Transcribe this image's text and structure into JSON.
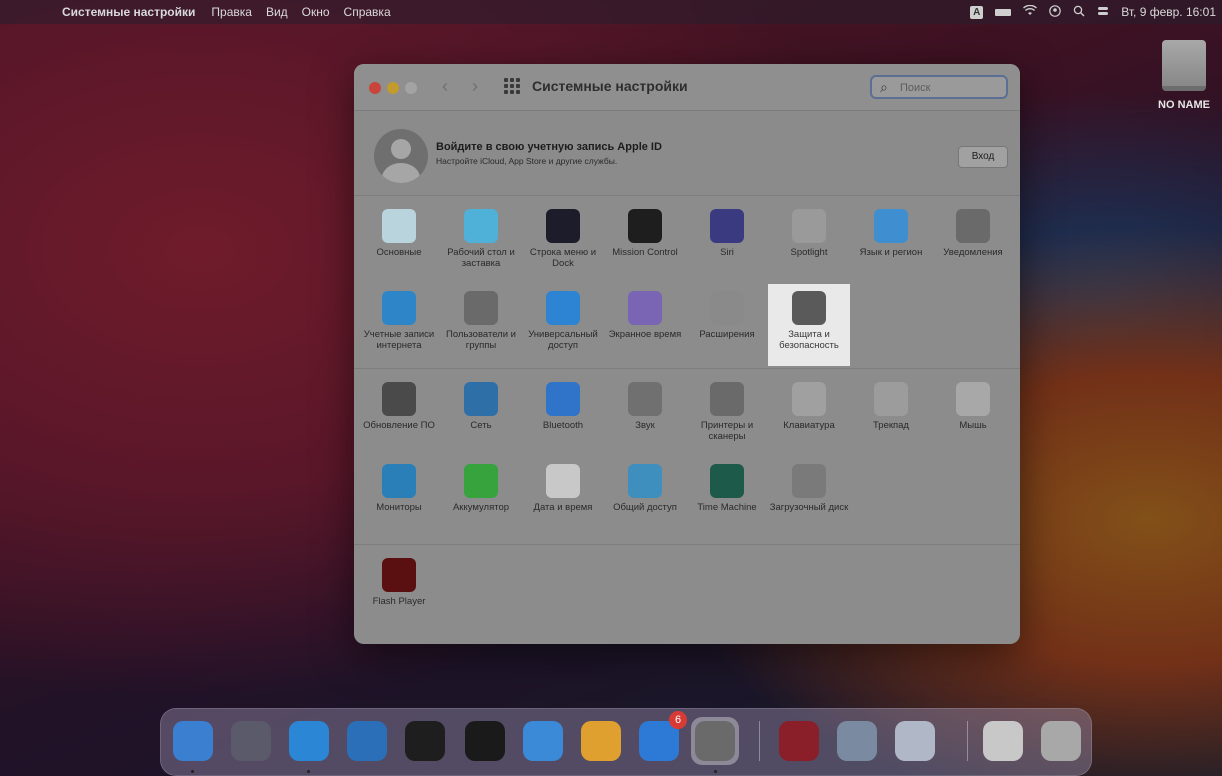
{
  "menubar": {
    "apple_glyph": "",
    "app_name": "Системные настройки",
    "items": [
      "Правка",
      "Вид",
      "Окно",
      "Справка"
    ],
    "input_source": "A",
    "clock": "Вт, 9 февр. 16:01"
  },
  "desktop": {
    "drive_label": "NO NAME"
  },
  "window": {
    "title": "Системные настройки",
    "nav_back": "‹",
    "nav_forward": "›",
    "search_glyph": "⌕",
    "search_placeholder": "Поиск",
    "search_value": ""
  },
  "apple_id": {
    "title": "Войдите в свою учетную запись Apple ID",
    "subtitle": "Настройте iCloud, App Store и другие службы.",
    "login_button": "Вход"
  },
  "section1": [
    {
      "name": "general",
      "label": "Основные",
      "color": "#b9d4dc"
    },
    {
      "name": "desktop",
      "label": "Рабочий стол и заставка",
      "color": "#4fb0d8"
    },
    {
      "name": "dock",
      "label": "Строка меню и Dock",
      "color": "#1c1c2a"
    },
    {
      "name": "mission-control",
      "label": "Mission Control",
      "color": "#1e1e1e"
    },
    {
      "name": "siri",
      "label": "Siri",
      "color": "#3a3a80"
    },
    {
      "name": "spotlight",
      "label": "Spotlight",
      "color": "#9a9a9a"
    },
    {
      "name": "language",
      "label": "Язык и регион",
      "color": "#3f8fd0"
    },
    {
      "name": "notifications",
      "label": "Уведомления",
      "color": "#6a6a6a"
    },
    {
      "name": "internet-accounts",
      "label": "Учетные записи интернета",
      "color": "#2e86c8"
    },
    {
      "name": "users",
      "label": "Пользователи и группы",
      "color": "#6a6a6a"
    },
    {
      "name": "accessibility",
      "label": "Универсальный доступ",
      "color": "#2d84d2"
    },
    {
      "name": "screen-time",
      "label": "Экранное время",
      "color": "#7a64b4"
    },
    {
      "name": "extensions",
      "label": "Расширения",
      "color": "#8a8a8a"
    },
    {
      "name": "security",
      "label": "Защита и безопасность",
      "color": "#5a5a5a"
    }
  ],
  "section2": [
    {
      "name": "software-update",
      "label": "Обновление ПО",
      "color": "#4a4a4a"
    },
    {
      "name": "network",
      "label": "Сеть",
      "color": "#2f6fa8"
    },
    {
      "name": "bluetooth",
      "label": "Bluetooth",
      "color": "#2f74c8"
    },
    {
      "name": "sound",
      "label": "Звук",
      "color": "#707070"
    },
    {
      "name": "printers",
      "label": "Принтеры и сканеры",
      "color": "#6a6a6a"
    },
    {
      "name": "keyboard",
      "label": "Клавиатура",
      "color": "#a0a0a0"
    },
    {
      "name": "trackpad",
      "label": "Трекпад",
      "color": "#9c9c9c"
    },
    {
      "name": "mouse",
      "label": "Мышь",
      "color": "#a8a8a8"
    },
    {
      "name": "displays",
      "label": "Мониторы",
      "color": "#2a7fb8"
    },
    {
      "name": "battery",
      "label": "Аккумулятор",
      "color": "#36a33c"
    },
    {
      "name": "date-time",
      "label": "Дата и время",
      "color": "#c8c8c8"
    },
    {
      "name": "sharing",
      "label": "Общий доступ",
      "color": "#3f8fbe"
    },
    {
      "name": "time-machine",
      "label": "Time Machine",
      "color": "#1d5a4a"
    },
    {
      "name": "startup-disk",
      "label": "Загрузочный диск",
      "color": "#7a7a7a"
    }
  ],
  "section3": [
    {
      "name": "flash-player",
      "label": "Flash Player",
      "color": "#5a1010"
    }
  ],
  "dock": {
    "appstore_badge": "6",
    "items": [
      {
        "name": "finder",
        "color": "#3a7fd0"
      },
      {
        "name": "launchpad",
        "color": "#5a5a6a"
      },
      {
        "name": "safari",
        "color": "#2c86d6"
      },
      {
        "name": "vscode",
        "color": "#2a6fb8"
      },
      {
        "name": "activity-monitor",
        "color": "#1e1e1e"
      },
      {
        "name": "terminal",
        "color": "#1a1a1a"
      },
      {
        "name": "mail",
        "color": "#3a8ad8"
      },
      {
        "name": "photos",
        "color": "#e0a030"
      },
      {
        "name": "app-store",
        "color": "#2d7ad6"
      },
      {
        "name": "system-preferences",
        "color": "#6a6a6a"
      },
      {
        "name": "rar",
        "color": "#8a1f2a"
      },
      {
        "name": "preview",
        "color": "#7a8aa0"
      },
      {
        "name": "flower-app",
        "color": "#b0b8c8"
      },
      {
        "name": "downloads-stack",
        "color": "#c8c8c8"
      },
      {
        "name": "trash",
        "color": "#a8a8a8"
      }
    ]
  }
}
